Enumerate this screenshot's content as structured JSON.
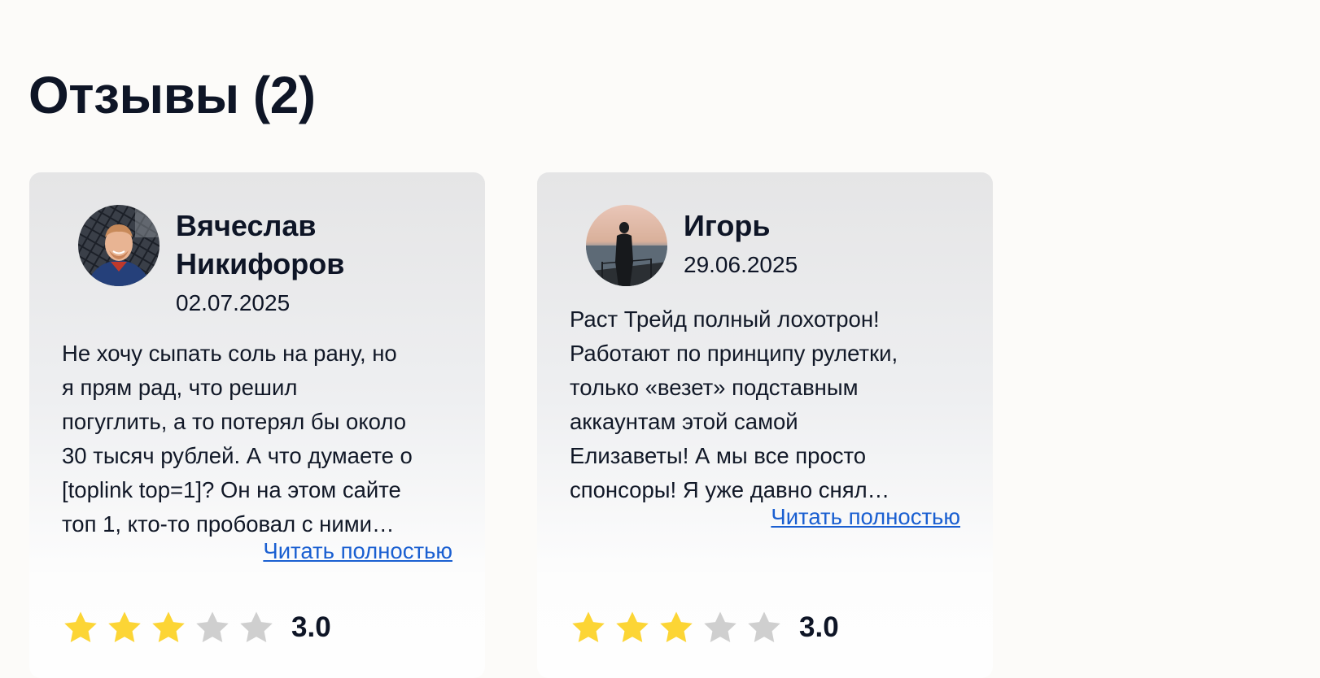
{
  "section": {
    "title": "Отзывы (2)"
  },
  "reviews": [
    {
      "author": "Вячеслав\nНикифоров",
      "date": "02.07.2025",
      "text": "Не хочу сыпать соль на рану, но\nя прям рад, что решил\nпогуглить, а то потерял бы около\n30 тысяч рублей. А что думаете о\n[toplink top=1]? Он на этом сайте\nтоп 1, кто-то пробовал с ними…",
      "read_more": "Читать полностью",
      "rating": 3,
      "rating_label": "3.0",
      "avatar_icon": "user-photo-avatar"
    },
    {
      "author": "Игорь",
      "date": "29.06.2025",
      "text": "Раст Трейд полный лохотрон!\nРаботают по принципу рулетки,\nтолько «везет» подставным\nаккаунтам этой самой\nЕлизаветы! А мы все просто\nспонсоры! Я уже давно снял…",
      "read_more": "Читать полностью",
      "rating": 3,
      "rating_label": "3.0",
      "avatar_icon": "user-photo-avatar"
    }
  ],
  "colors": {
    "page_background": "#fcfbf9",
    "text_dark": "#0e1526",
    "link": "#1a5fd1",
    "star_filled": "#fcd535",
    "star_empty": "#cfcfcf"
  },
  "rating_max": 5
}
